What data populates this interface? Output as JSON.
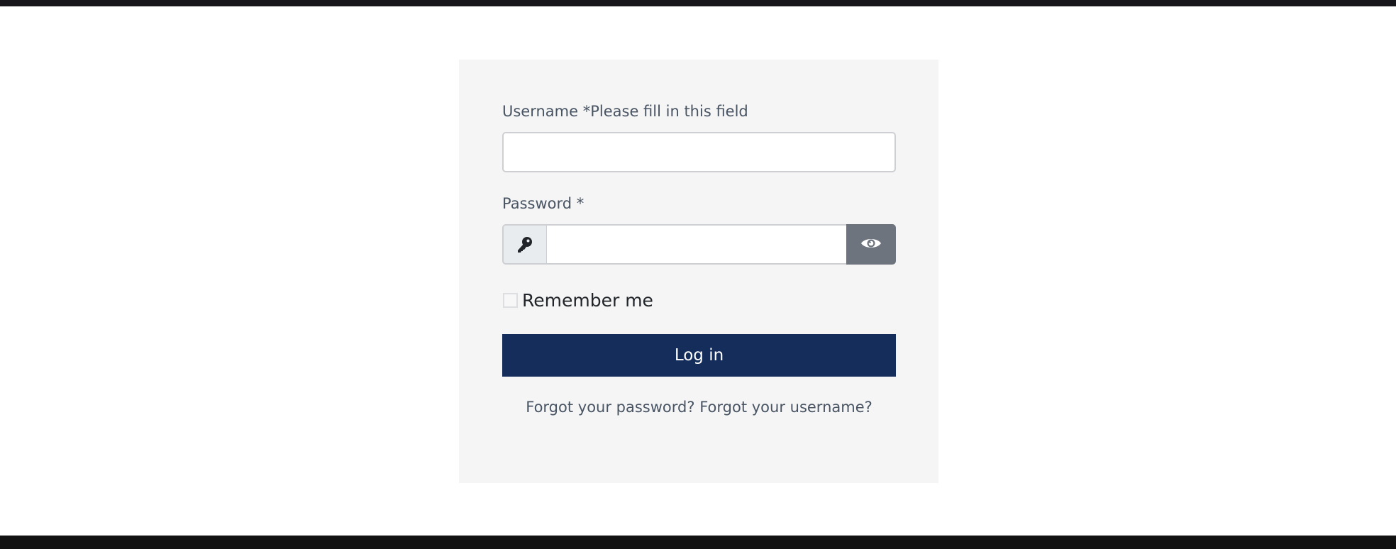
{
  "form": {
    "username_label": "Username *",
    "username_hint": "Please fill in this field",
    "username_value": "",
    "password_label": "Password *",
    "password_value": "",
    "remember_label": "Remember me",
    "remember_checked": false,
    "login_label": "Log in"
  },
  "links": {
    "forgot_password": "Forgot your password?",
    "forgot_username": "Forgot your username?"
  },
  "icons": {
    "password_addon": "key-icon",
    "password_toggle": "eye-icon"
  },
  "colors": {
    "primary": "#142d5b",
    "toggle": "#6d747d",
    "card_background": "#f5f5f5",
    "label_text": "#495463"
  }
}
